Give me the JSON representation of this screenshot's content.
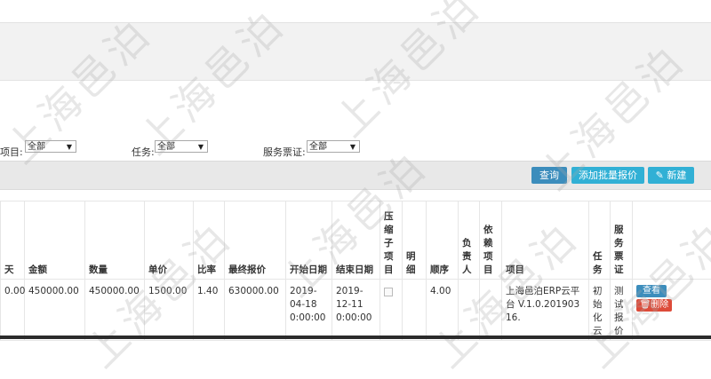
{
  "filters": {
    "project_label": "项目:",
    "project_value": "全部",
    "task_label": "任务:",
    "task_value": "全部",
    "voucher_label": "服务票证:",
    "voucher_value": "全部"
  },
  "toolbar": {
    "query_label": "查询",
    "batch_add_label": "添加批量报价",
    "new_label": "新建",
    "new_icon": "pencil-icon"
  },
  "table": {
    "headers": [
      "天",
      "金额",
      "数量",
      "单价",
      "比率",
      "最终报价",
      "开始日期",
      "结束日期",
      "压缩子项目",
      "明细",
      "顺序",
      "负责人",
      "依赖项目",
      "项目",
      "任务",
      "服务票证",
      ""
    ],
    "rows": [
      {
        "days": "0.00",
        "amount": "450000.00",
        "quantity": "450000.00",
        "unit_price": "1500.00",
        "ratio": "1.40",
        "final_quote": "630000.00",
        "start_date": "2019-04-18 0:00:00",
        "end_date": "2019-12-11 0:00:00",
        "compress": "",
        "detail": "",
        "order": "4.00",
        "owner": "",
        "depends": "",
        "project": "上海邑泊ERP云平台 V.1.0.20190316.",
        "task": "初始化云",
        "voucher": "测试报价",
        "view_label": "查看",
        "delete_label": "删除",
        "delete_icon": "trash-icon"
      }
    ]
  },
  "watermark": "上海邑泊",
  "colors": {
    "primary": "#3c8dbc",
    "info": "#31b0d5",
    "danger": "#dd4b39"
  }
}
